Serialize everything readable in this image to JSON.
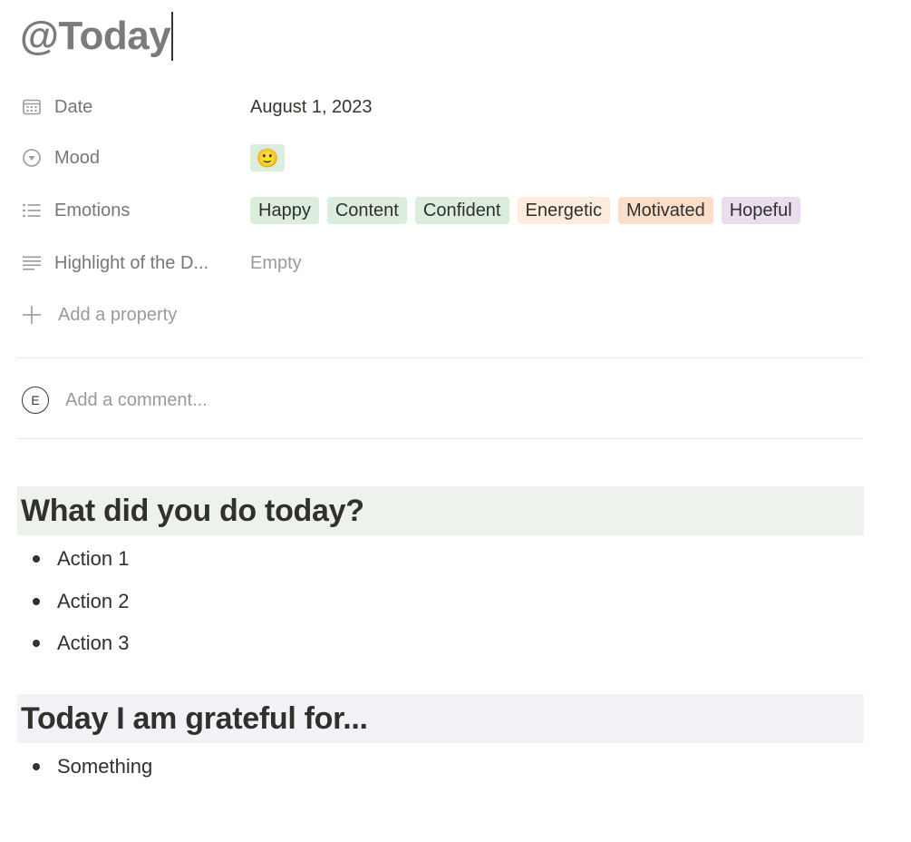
{
  "page": {
    "title": "@Today"
  },
  "properties": [
    {
      "name": "Date",
      "icon": "calendar-icon",
      "value": "August 1, 2023"
    },
    {
      "name": "Mood",
      "icon": "select-icon",
      "value": "🙂"
    },
    {
      "name": "Emotions",
      "icon": "multi-select-list-icon",
      "tags": [
        {
          "label": "Happy",
          "color": "#dbeddb"
        },
        {
          "label": "Content",
          "color": "#dbeddb"
        },
        {
          "label": "Confident",
          "color": "#dbeddb"
        },
        {
          "label": "Energetic",
          "color": "#fbecdd"
        },
        {
          "label": "Motivated",
          "color": "#fadec9"
        },
        {
          "label": "Hopeful",
          "color": "#e8deee"
        }
      ]
    },
    {
      "name": "Highlight of the D...",
      "icon": "text-lines-icon",
      "value": "Empty"
    }
  ],
  "add_property_label": "Add a property",
  "comment": {
    "avatar_letter": "E",
    "placeholder": "Add a comment..."
  },
  "sections": [
    {
      "heading": "What did you do today?",
      "background": "#edf3ec",
      "items": [
        "Action 1",
        "Action 2",
        "Action 3"
      ]
    },
    {
      "heading": "Today I am grateful for...",
      "background": "#f4f2f7",
      "items": [
        "Something"
      ]
    }
  ],
  "colors": {
    "mood_tag_bg": "#dbeddb",
    "title_color": "#7b7b7b"
  }
}
